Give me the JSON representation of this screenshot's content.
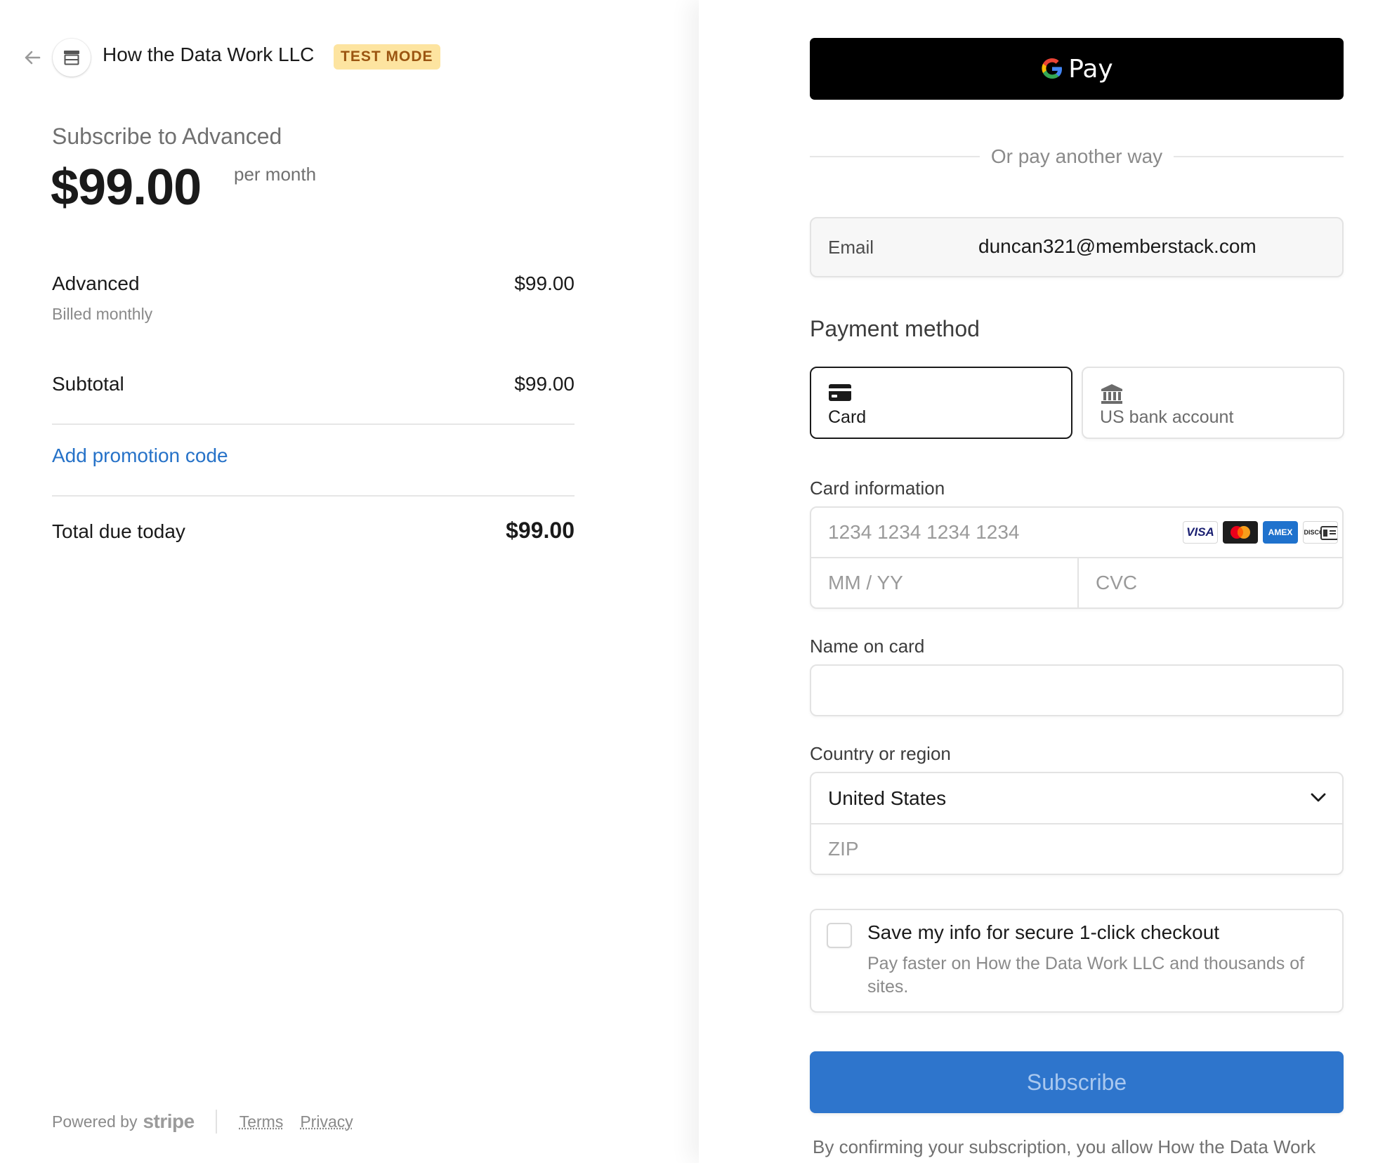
{
  "header": {
    "merchant_name": "How the Data Work LLC",
    "test_mode_badge": "TEST MODE"
  },
  "summary": {
    "title": "Subscribe to Advanced",
    "price": "$99.00",
    "price_period": "per month",
    "line_item": {
      "name": "Advanced",
      "description": "Billed monthly",
      "amount": "$99.00"
    },
    "subtotal_label": "Subtotal",
    "subtotal_amount": "$99.00",
    "promo_link": "Add promotion code",
    "total_label": "Total due today",
    "total_amount": "$99.00"
  },
  "footer": {
    "powered_by": "Powered by",
    "brand": "stripe",
    "terms": "Terms",
    "privacy": "Privacy"
  },
  "payment": {
    "gpay_label": "Pay",
    "or_text": "Or pay another way",
    "email_label": "Email",
    "email_value": "duncan321@memberstack.com",
    "method_title": "Payment method",
    "methods": [
      {
        "label": "Card",
        "selected": true,
        "icon": "credit-card-icon"
      },
      {
        "label": "US bank account",
        "selected": false,
        "icon": "bank-icon"
      }
    ],
    "card_info_label": "Card information",
    "card_number_placeholder": "1234 1234 1234 1234",
    "card_brands": [
      "VISA",
      "Mastercard",
      "AMEX",
      "DISCOVER"
    ],
    "expiry_placeholder": "MM / YY",
    "cvc_placeholder": "CVC",
    "name_label": "Name on card",
    "name_value": "",
    "country_label": "Country or region",
    "country_value": "United States",
    "zip_placeholder": "ZIP",
    "save_info_title": "Save my info for secure 1-click checkout",
    "save_info_desc": "Pay faster on How the Data Work LLC and thousands of sites.",
    "save_info_checked": false,
    "subscribe_label": "Subscribe",
    "confirm_text": "By confirming your subscription, you allow How the Data Work"
  },
  "colors": {
    "accent_blue": "#2e75cc",
    "link_blue": "#2672c8",
    "badge_bg": "#fde4a0",
    "badge_text": "#9b5511"
  }
}
